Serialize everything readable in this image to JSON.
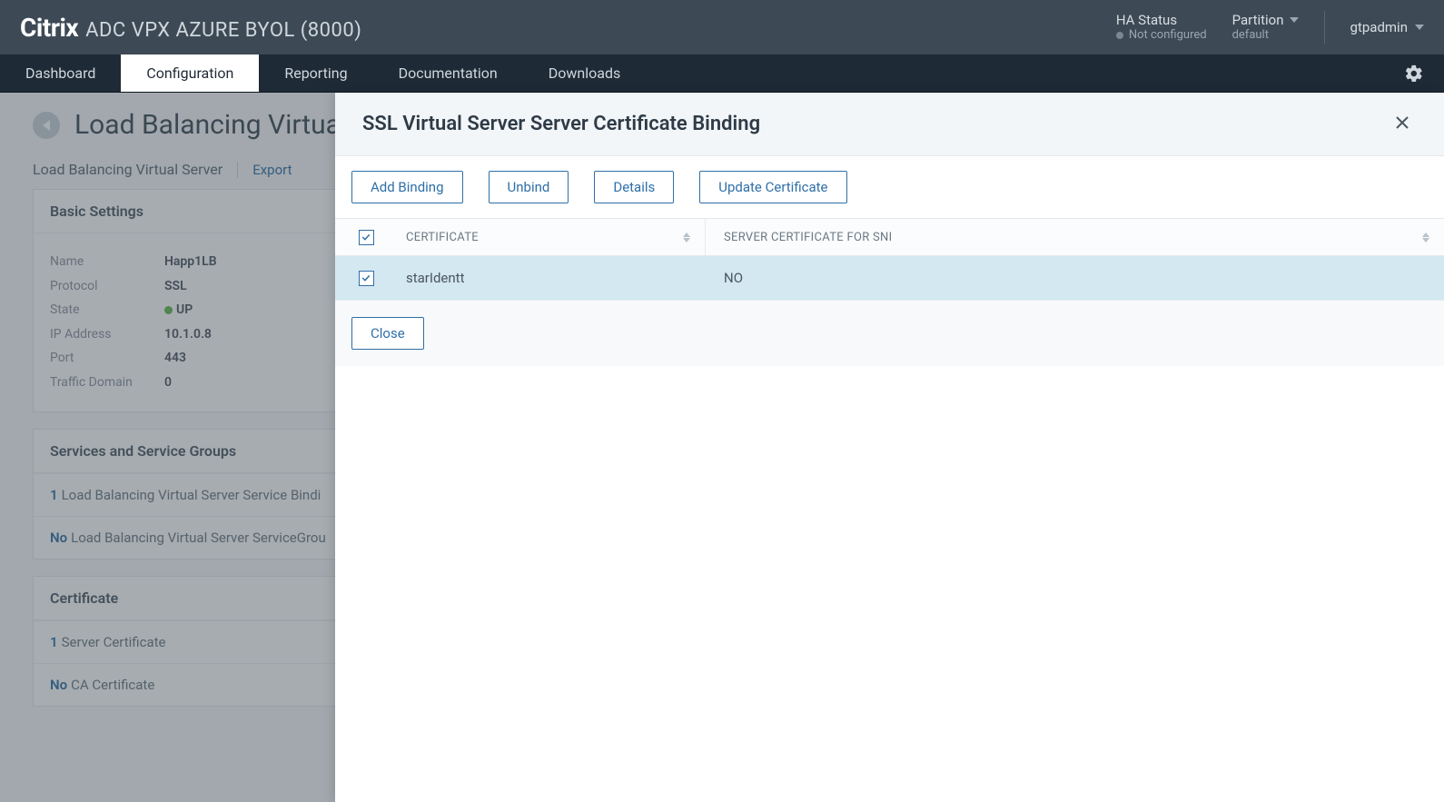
{
  "brand": {
    "name": "Citrix",
    "suffix": "ADC VPX AZURE BYOL (8000)"
  },
  "ha": {
    "label": "HA Status",
    "value": "Not configured"
  },
  "partition": {
    "label": "Partition",
    "value": "default"
  },
  "user": {
    "name": "gtpadmin"
  },
  "nav": {
    "items": [
      {
        "label": "Dashboard"
      },
      {
        "label": "Configuration"
      },
      {
        "label": "Reporting"
      },
      {
        "label": "Documentation"
      },
      {
        "label": "Downloads"
      }
    ]
  },
  "page": {
    "title": "Load Balancing Virtual",
    "breadcrumb": "Load Balancing Virtual Server",
    "export": "Export"
  },
  "basic": {
    "heading": "Basic Settings",
    "name_label": "Name",
    "name_value": "Happ1LB",
    "protocol_label": "Protocol",
    "protocol_value": "SSL",
    "state_label": "State",
    "state_value": "UP",
    "ip_label": "IP Address",
    "ip_value": "10.1.0.8",
    "port_label": "Port",
    "port_value": "443",
    "td_label": "Traffic Domain",
    "td_value": "0"
  },
  "services": {
    "heading": "Services and Service Groups",
    "row1_count": "1",
    "row1_text": "Load Balancing Virtual Server Service Bindi",
    "row2_count": "No",
    "row2_text": "Load Balancing Virtual Server ServiceGrou"
  },
  "cert_section": {
    "heading": "Certificate",
    "row1_count": "1",
    "row1_text": "Server Certificate",
    "row2_count": "No",
    "row2_text": "CA Certificate"
  },
  "modal": {
    "title": "SSL Virtual Server Server Certificate Binding",
    "add_binding": "Add Binding",
    "unbind": "Unbind",
    "details": "Details",
    "update_cert": "Update Certificate",
    "col_cert": "CERTIFICATE",
    "col_sni": "SERVER CERTIFICATE FOR SNI",
    "rows": [
      {
        "cert": "starIdentt",
        "sni": "NO"
      }
    ],
    "close": "Close"
  }
}
